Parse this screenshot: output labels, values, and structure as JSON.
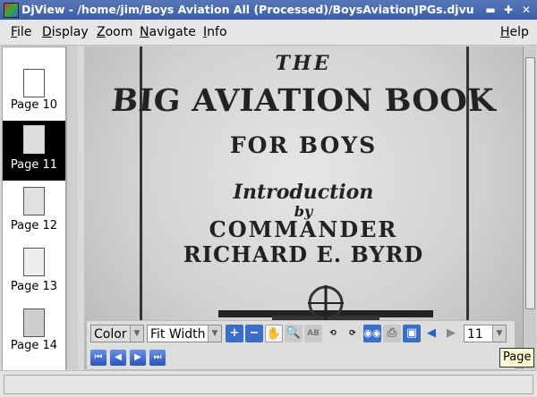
{
  "window": {
    "title": "DjView - /home/jim/Boys Aviation All (Processed)/BoysAviationJPGs.djvu/B"
  },
  "menu": {
    "file": "File",
    "display": "Display",
    "zoom": "Zoom",
    "navigate": "Navigate",
    "info": "Info",
    "help": "Help"
  },
  "thumbnails": [
    {
      "label": "Page 10"
    },
    {
      "label": "Page 11",
      "selected": true
    },
    {
      "label": "Page 12"
    },
    {
      "label": "Page 13"
    },
    {
      "label": "Page 14"
    }
  ],
  "document": {
    "line1": "THE",
    "line2": "BIG AVIATION BOOK",
    "line3": "FOR BOYS",
    "line4": "Introduction",
    "line5": "by",
    "line6": "COMMANDER",
    "line7": "RICHARD E. BYRD"
  },
  "toolbar": {
    "color_mode": "Color",
    "zoom_mode": "Fit Width",
    "page_number": "11"
  },
  "tooltip": "Page",
  "colors": {
    "titlebar": "#3b5ea7",
    "selection": "#000000",
    "tool_blue": "#3c6ec8"
  }
}
